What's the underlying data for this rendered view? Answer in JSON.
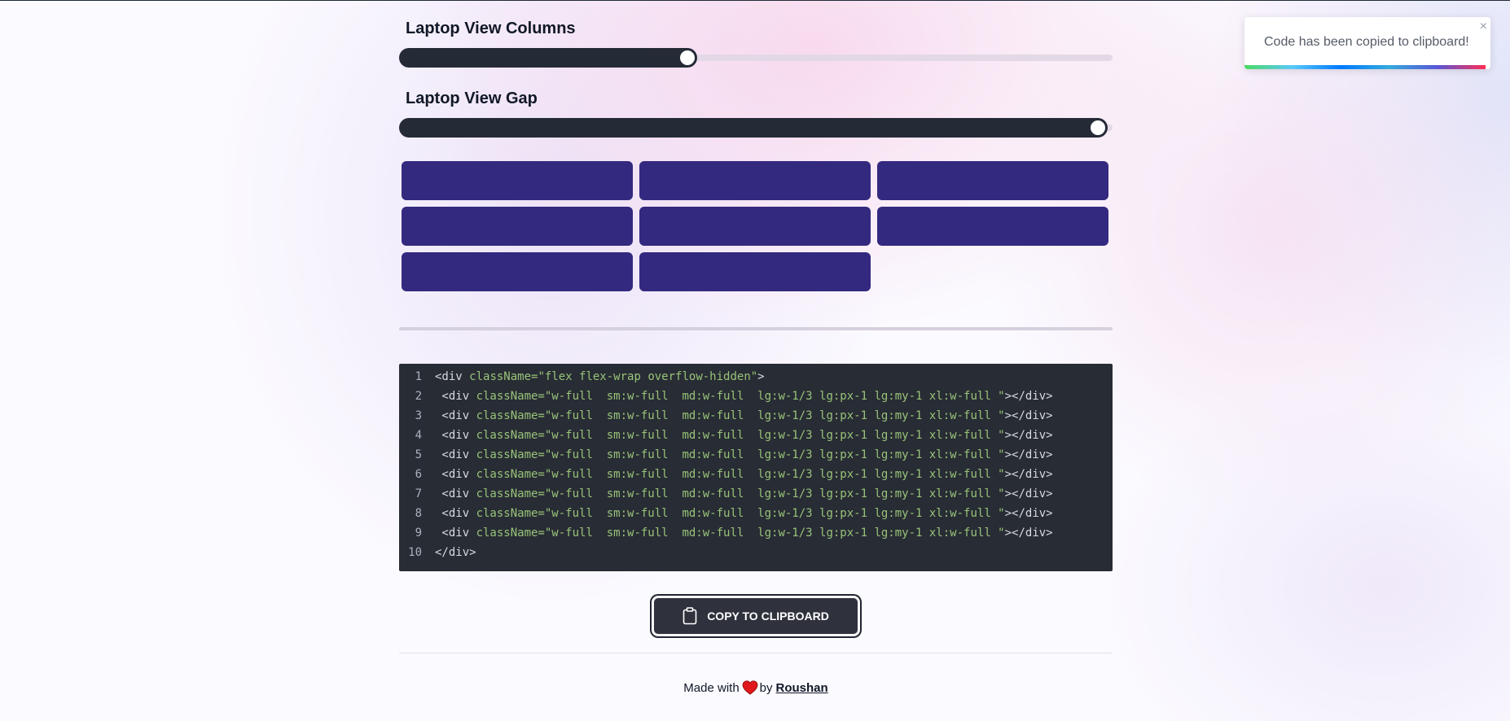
{
  "columns": {
    "label": "Laptop View Columns",
    "value": 0.4
  },
  "gap": {
    "label": "Laptop View Gap",
    "value": 1.0
  },
  "preview": {
    "box_count": 8,
    "columns": 3,
    "box_color": "#33297f"
  },
  "code": {
    "lines": [
      {
        "num": "1",
        "indent": "",
        "open": "<div ",
        "attr": "className=",
        "value": "\"flex flex-wrap overflow-hidden\"",
        "close": ">"
      },
      {
        "num": "2",
        "indent": " ",
        "open": "<div ",
        "attr": "className=",
        "value": "\"w-full  sm:w-full  md:w-full  lg:w-1/3 lg:px-1 lg:my-1 xl:w-full \"",
        "close": "></div>"
      },
      {
        "num": "3",
        "indent": " ",
        "open": "<div ",
        "attr": "className=",
        "value": "\"w-full  sm:w-full  md:w-full  lg:w-1/3 lg:px-1 lg:my-1 xl:w-full \"",
        "close": "></div>"
      },
      {
        "num": "4",
        "indent": " ",
        "open": "<div ",
        "attr": "className=",
        "value": "\"w-full  sm:w-full  md:w-full  lg:w-1/3 lg:px-1 lg:my-1 xl:w-full \"",
        "close": "></div>"
      },
      {
        "num": "5",
        "indent": " ",
        "open": "<div ",
        "attr": "className=",
        "value": "\"w-full  sm:w-full  md:w-full  lg:w-1/3 lg:px-1 lg:my-1 xl:w-full \"",
        "close": "></div>"
      },
      {
        "num": "6",
        "indent": " ",
        "open": "<div ",
        "attr": "className=",
        "value": "\"w-full  sm:w-full  md:w-full  lg:w-1/3 lg:px-1 lg:my-1 xl:w-full \"",
        "close": "></div>"
      },
      {
        "num": "7",
        "indent": " ",
        "open": "<div ",
        "attr": "className=",
        "value": "\"w-full  sm:w-full  md:w-full  lg:w-1/3 lg:px-1 lg:my-1 xl:w-full \"",
        "close": "></div>"
      },
      {
        "num": "8",
        "indent": " ",
        "open": "<div ",
        "attr": "className=",
        "value": "\"w-full  sm:w-full  md:w-full  lg:w-1/3 lg:px-1 lg:my-1 xl:w-full \"",
        "close": "></div>"
      },
      {
        "num": "9",
        "indent": " ",
        "open": "<div ",
        "attr": "className=",
        "value": "\"w-full  sm:w-full  md:w-full  lg:w-1/3 lg:px-1 lg:my-1 xl:w-full \"",
        "close": "></div>"
      },
      {
        "num": "10",
        "indent": "",
        "open": "</div>",
        "attr": "",
        "value": "",
        "close": ""
      }
    ]
  },
  "copy_button": {
    "label": "COPY TO CLIPBOARD",
    "icon": "clipboard-icon"
  },
  "footer": {
    "prefix": "Made with",
    "icon": "heart-icon",
    "by": "by",
    "author": "Roushan"
  },
  "toast": {
    "message": "Code has been copied to clipboard!",
    "close": "×",
    "progress": 1.0
  },
  "colors": {
    "accent": "#252a37",
    "box": "#33297f",
    "code_bg": "#282c34",
    "code_string": "#98c379",
    "heart": "#e0181b"
  }
}
